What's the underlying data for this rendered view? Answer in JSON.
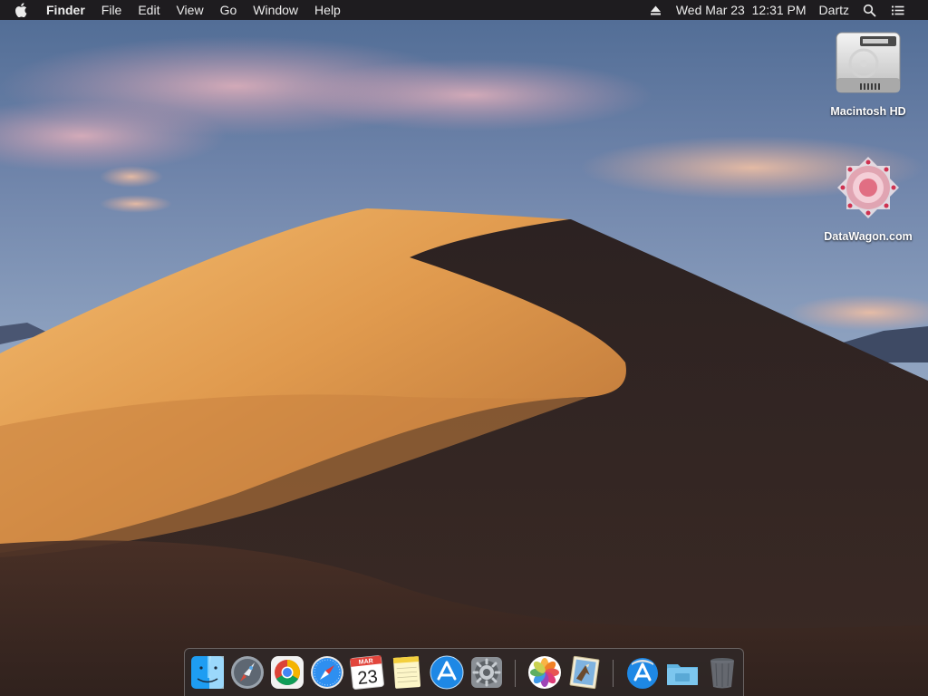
{
  "menubar": {
    "app_name": "Finder",
    "menus": [
      "File",
      "Edit",
      "View",
      "Go",
      "Window",
      "Help"
    ],
    "datetime": "Wed Mar 23  12:31 PM",
    "user": "Dartz",
    "icons": [
      "apple-icon",
      "eject-icon",
      "spotlight-search-icon",
      "notification-center-icon"
    ]
  },
  "desktop": {
    "icons": [
      {
        "label": "Macintosh HD",
        "icon": "hard-drive-icon"
      },
      {
        "label": "DataWagon.com",
        "icon": "datawagon-logo-icon"
      }
    ]
  },
  "dock": {
    "items": [
      {
        "app": "finder",
        "icon": "finder-icon",
        "running": true
      },
      {
        "app": "launchpad",
        "icon": "launchpad-icon",
        "running": false
      },
      {
        "app": "chrome",
        "icon": "chrome-icon",
        "running": true
      },
      {
        "app": "safari",
        "icon": "safari-icon",
        "running": true
      },
      {
        "app": "calendar",
        "icon": "calendar-icon",
        "running": false,
        "month": "MAR",
        "day": "23"
      },
      {
        "app": "notes",
        "icon": "notes-icon",
        "running": false
      },
      {
        "app": "app-store",
        "icon": "app-store-icon",
        "running": false
      },
      {
        "app": "system-preferences",
        "icon": "system-preferences-icon",
        "running": false
      },
      {
        "app": "photos",
        "icon": "photos-icon",
        "running": false
      },
      {
        "app": "mail",
        "icon": "mail-icon",
        "running": false
      },
      {
        "app": "applications-folder",
        "icon": "applications-stack-icon",
        "running": false
      },
      {
        "app": "documents-folder",
        "icon": "folder-stack-icon",
        "running": false
      },
      {
        "app": "trash",
        "icon": "trash-icon",
        "running": false
      }
    ]
  },
  "colors": {
    "menubar_bg": "#1e1c1f",
    "sky_top": "#4d6a92",
    "sand_light": "#f2b869",
    "sand_dark": "#2e2222"
  }
}
